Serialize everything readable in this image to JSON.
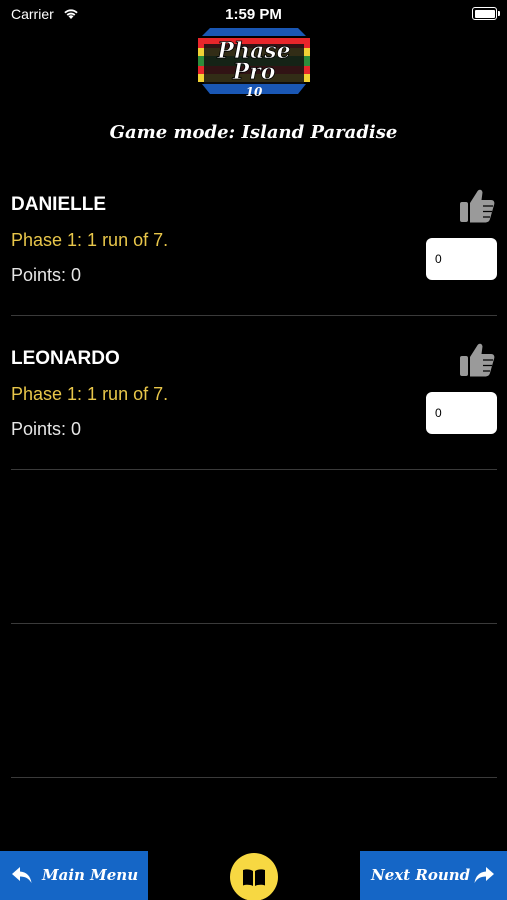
{
  "status_bar": {
    "carrier": "Carrier",
    "time": "1:59 PM"
  },
  "logo": {
    "line1": "Phase",
    "line2": "Pro",
    "line3": "10"
  },
  "game_mode": "Game mode: Island Paradise",
  "players": [
    {
      "name": "DANIELLE",
      "phase": "Phase 1: 1 run of 7.",
      "points": "Points: 0",
      "score_value": "0"
    },
    {
      "name": "LEONARDO",
      "phase": "Phase 1: 1 run of 7.",
      "points": "Points: 0",
      "score_value": "0"
    }
  ],
  "footer": {
    "main_menu": "Main Menu",
    "next_round": "Next Round"
  },
  "colors": {
    "background": "#000000",
    "phase_text": "#e8c64a",
    "button_blue": "#1566c6",
    "rules_yellow": "#f7d842"
  }
}
